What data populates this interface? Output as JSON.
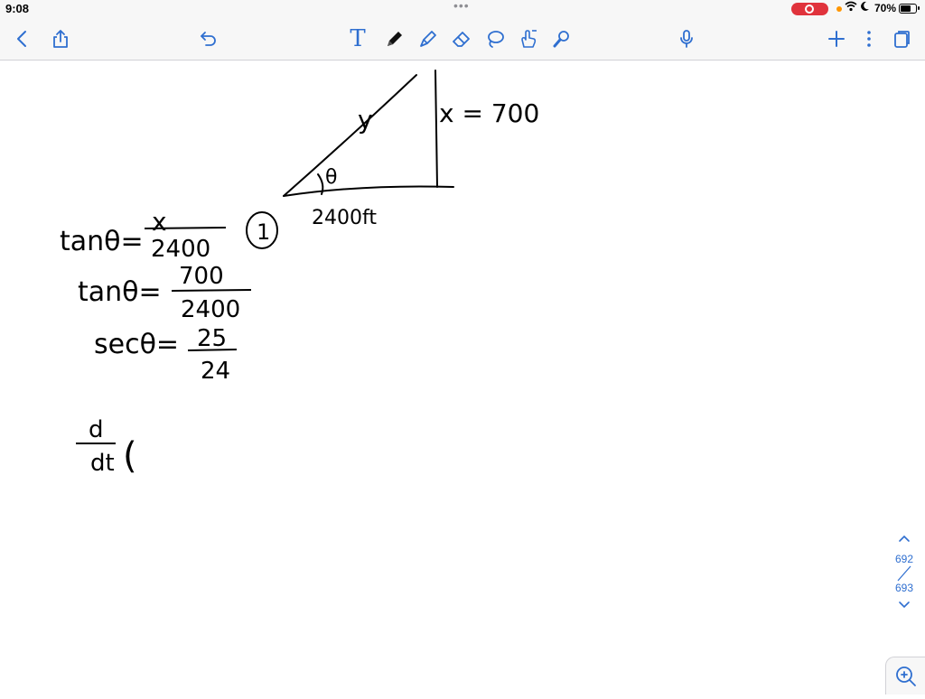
{
  "status": {
    "time": "9:08",
    "dots": "•••",
    "battery": "70%",
    "battery_level": 0.7
  },
  "toolbar": {
    "left": [
      {
        "name": "back-icon"
      },
      {
        "name": "share-icon"
      },
      {
        "name": "undo-icon"
      }
    ],
    "tools": [
      {
        "name": "text-tool-icon",
        "glyph": "T"
      },
      {
        "name": "pen-tool-icon"
      },
      {
        "name": "highlighter-tool-icon"
      },
      {
        "name": "eraser-tool-icon"
      },
      {
        "name": "lasso-tool-icon"
      },
      {
        "name": "shape-tool-icon"
      },
      {
        "name": "laser-pointer-icon"
      }
    ],
    "right": [
      {
        "name": "microphone-icon"
      },
      {
        "name": "add-page-icon"
      },
      {
        "name": "more-icon"
      },
      {
        "name": "pages-icon"
      }
    ],
    "accent": "#2f6fd0"
  },
  "note": {
    "triangle": {
      "hyp_label": "y",
      "angle_label": "θ",
      "vertical_label": "x = 700",
      "base_label": "2400ft"
    },
    "eq1": {
      "lhs": "tanθ=",
      "num": "x",
      "den": "2400",
      "tag": "1"
    },
    "eq2": {
      "lhs": "tanθ=",
      "num": "700",
      "den": "2400"
    },
    "eq3": {
      "lhs": "secθ=",
      "num": "25",
      "den": "24"
    },
    "deriv": {
      "num": "d",
      "den": "dt",
      "paren": "("
    }
  },
  "page_nav": {
    "current": "692",
    "total": "693"
  }
}
